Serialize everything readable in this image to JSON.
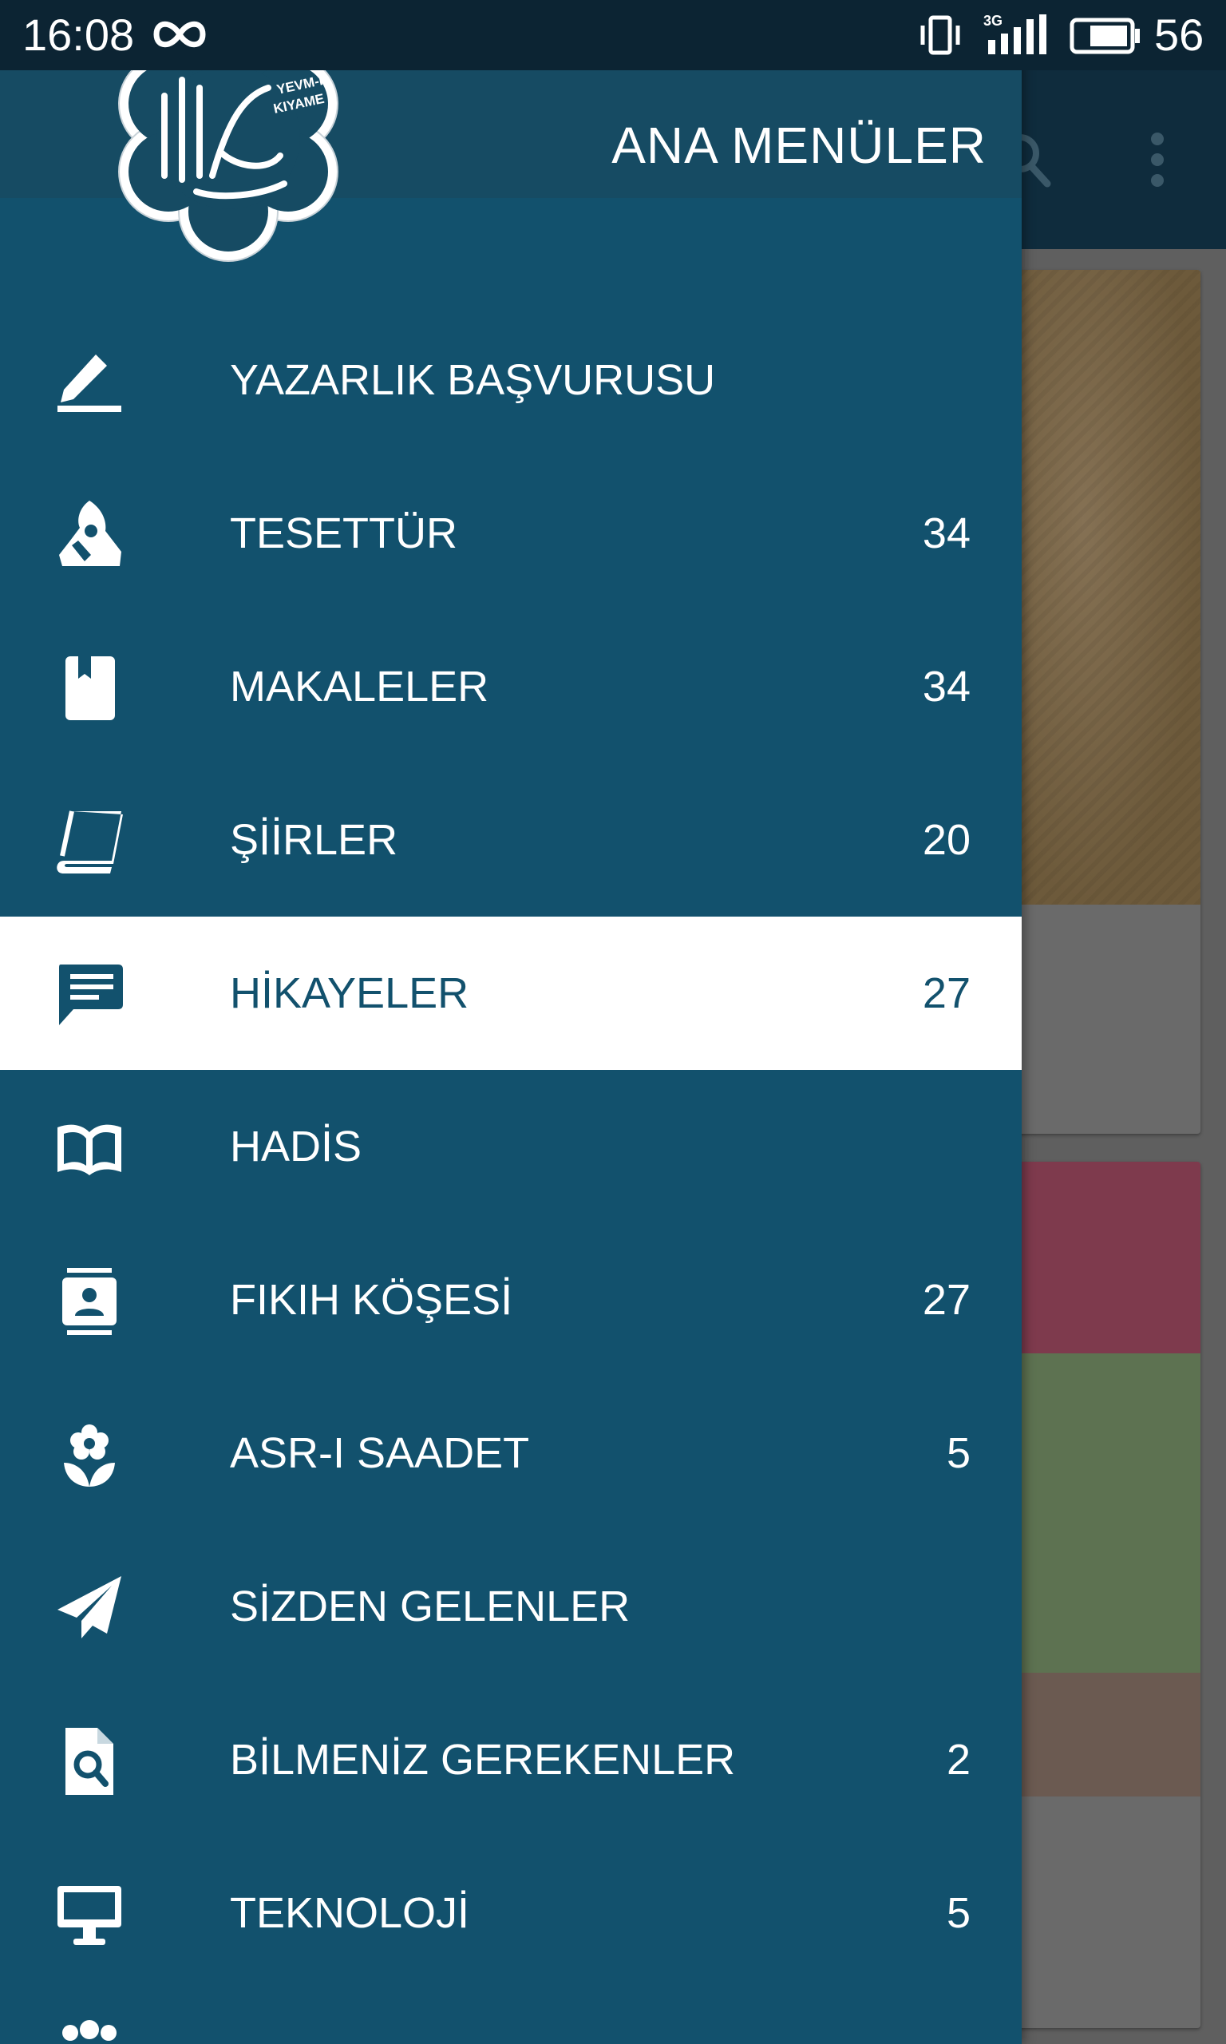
{
  "status_bar": {
    "time": "16:08",
    "network_label": "3G",
    "battery_percent": "56"
  },
  "drawer": {
    "title": "ANA MENÜLER",
    "logo_text": "YEVM-İL KIYAME",
    "items": [
      {
        "label": "YAZARLIK BAŞVURUSU",
        "count": "",
        "icon": "pencil-icon"
      },
      {
        "label": "TESETTÜR",
        "count": "34",
        "icon": "veiled-woman-icon"
      },
      {
        "label": "MAKALELER",
        "count": "34",
        "icon": "bookmark-book-icon"
      },
      {
        "label": "ŞİİRLER",
        "count": "20",
        "icon": "book-icon"
      },
      {
        "label": "HİKAYELER",
        "count": "27",
        "icon": "chat-text-icon",
        "active": true
      },
      {
        "label": "HADİS",
        "count": "",
        "icon": "open-book-icon"
      },
      {
        "label": "FIKIH KÖŞESİ",
        "count": "27",
        "icon": "contact-card-icon"
      },
      {
        "label": "ASR-I SAADET",
        "count": "5",
        "icon": "flower-icon"
      },
      {
        "label": "SİZDEN GELENLER",
        "count": "",
        "icon": "send-icon"
      },
      {
        "label": "BİLMENİZ GEREKENLER",
        "count": "2",
        "icon": "file-search-icon"
      },
      {
        "label": "TEKNOLOJİ",
        "count": "5",
        "icon": "monitor-icon"
      }
    ]
  },
  "colors": {
    "drawer_bg": "#12516d",
    "active_bg": "#ffffff",
    "active_text": "#12516d"
  }
}
